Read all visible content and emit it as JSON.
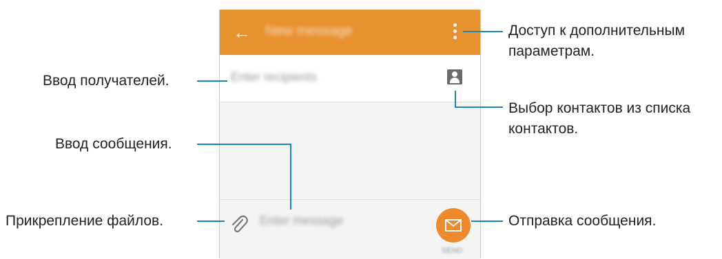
{
  "appbar": {
    "title": "New message"
  },
  "recipient": {
    "placeholder": "Enter recipients"
  },
  "compose": {
    "placeholder": "Enter message",
    "send_label": "SEND"
  },
  "colors": {
    "appbar": "#e8912f",
    "send_button": "#ee8a2c",
    "callout_line": "#1a86b8"
  },
  "callouts": {
    "more_options_line1": "Доступ к дополнительным",
    "more_options_line2": "параметрам.",
    "recipients": "Ввод получателей.",
    "contacts_line1": "Выбор контактов из списка",
    "contacts_line2": "контактов.",
    "message": "Ввод сообщения.",
    "attach": "Прикрепление файлов.",
    "send": "Отправка сообщения."
  }
}
